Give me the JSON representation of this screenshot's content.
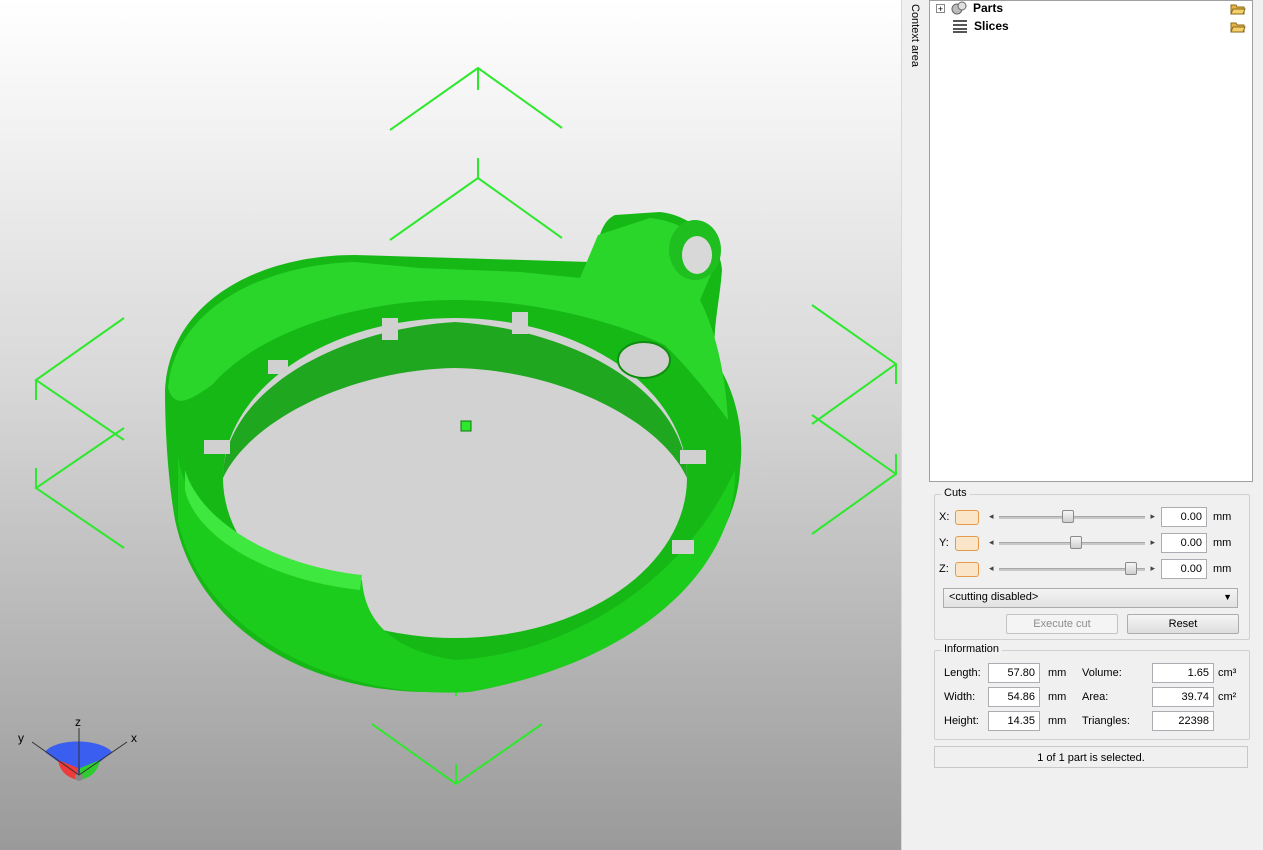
{
  "context_area": {
    "label": "Context area"
  },
  "tree": {
    "items": [
      {
        "label": "Parts",
        "expandable": true
      },
      {
        "label": "Slices",
        "expandable": false
      }
    ]
  },
  "cuts": {
    "title": "Cuts",
    "rows": [
      {
        "axis": "X:",
        "value": "0.00",
        "unit": "mm",
        "slider_fraction": 0.47
      },
      {
        "axis": "Y:",
        "value": "0.00",
        "unit": "mm",
        "slider_fraction": 0.53
      },
      {
        "axis": "Z:",
        "value": "0.00",
        "unit": "mm",
        "slider_fraction": 0.94
      }
    ],
    "mode_selected": "<cutting disabled>",
    "execute_label": "Execute cut",
    "reset_label": "Reset"
  },
  "information": {
    "title": "Information",
    "length_label": "Length:",
    "length_value": "57.80",
    "length_unit": "mm",
    "width_label": "Width:",
    "width_value": "54.86",
    "width_unit": "mm",
    "height_label": "Height:",
    "height_value": "14.35",
    "height_unit": "mm",
    "volume_label": "Volume:",
    "volume_value": "1.65",
    "volume_unit": "cm³",
    "area_label": "Area:",
    "area_value": "39.74",
    "area_unit": "cm²",
    "triangles_label": "Triangles:",
    "triangles_value": "22398"
  },
  "status": {
    "text": "1 of 1 part is selected."
  },
  "axes_widget": {
    "x": "x",
    "y": "y",
    "z": "z"
  },
  "colors": {
    "model": "#14c814",
    "gizmo": "#2ee82e",
    "accent": "#e39a4a"
  }
}
